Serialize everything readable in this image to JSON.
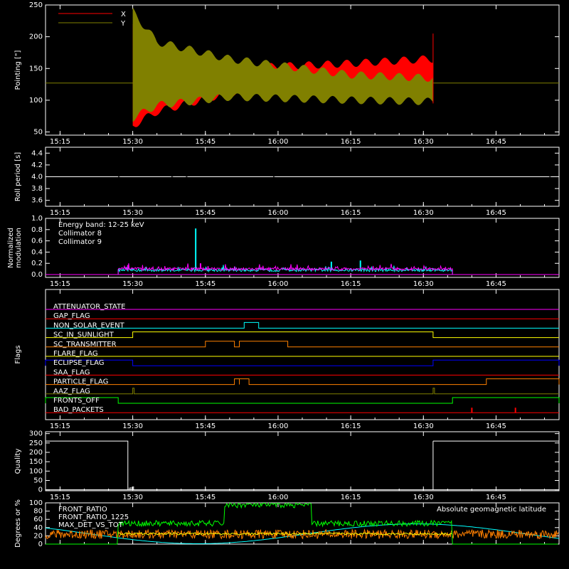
{
  "time_axis": {
    "ticks": [
      "15:15",
      "15:30",
      "15:45",
      "16:00",
      "16:15",
      "16:30",
      "16:45"
    ],
    "range": [
      "15:12",
      "16:58"
    ]
  },
  "chart_data": [
    {
      "id": "pointing",
      "type": "area",
      "ylabel": "Pointing [\"]",
      "ylim": [
        45,
        250
      ],
      "yticks": [
        "50",
        "100",
        "150",
        "200",
        "250"
      ],
      "legend_position": "top-left",
      "series": [
        {
          "name": "X",
          "color": "#ff0000",
          "baseline": 127,
          "t_start": "15:30",
          "t_end": "16:32",
          "envelope_upper": [
            [
              0,
              220
            ],
            [
              5,
              175
            ],
            [
              20,
              150
            ],
            [
              45,
              158
            ],
            [
              61,
              165
            ]
          ],
          "envelope_lower": [
            [
              0,
              60
            ],
            [
              5,
              82
            ],
            [
              20,
              112
            ],
            [
              45,
              125
            ],
            [
              61,
              120
            ]
          ]
        },
        {
          "name": "Y",
          "color": "#808000",
          "baseline": 127,
          "t_start": "15:30",
          "t_end": "16:32",
          "envelope_upper": [
            [
              0,
              240
            ],
            [
              5,
              192
            ],
            [
              20,
              165
            ],
            [
              45,
              140
            ],
            [
              61,
              135
            ]
          ],
          "envelope_lower": [
            [
              0,
              72
            ],
            [
              5,
              92
            ],
            [
              20,
              105
            ],
            [
              45,
              100
            ],
            [
              61,
              98
            ]
          ]
        }
      ]
    },
    {
      "id": "roll",
      "type": "line",
      "ylabel": "Roll period [s]",
      "ylim": [
        3.5,
        4.5
      ],
      "yticks": [
        "3.6",
        "3.8",
        "4.0",
        "4.2",
        "4.4"
      ],
      "value": 4.0,
      "color": "#ffffff"
    },
    {
      "id": "modulation",
      "type": "line",
      "ylabel": [
        "Normalized",
        "modulation"
      ],
      "ylim": [
        -0.05,
        1.0
      ],
      "yticks": [
        "0.0",
        "0.2",
        "0.4",
        "0.6",
        "0.8",
        "1.0"
      ],
      "annotation": "Energy band: 12-25 keV",
      "t_start": "15:27",
      "t_end": "16:36",
      "series": [
        {
          "name": "Collimator 8",
          "color": "#00ffff",
          "level": 0.08,
          "spikes": [
            [
              "15:43",
              0.82
            ],
            [
              "16:11",
              0.23
            ],
            [
              "16:17",
              0.25
            ]
          ]
        },
        {
          "name": "Collimator 9",
          "color": "#ff00ff",
          "level": 0.1,
          "spikes": [
            [
              "15:29",
              0.17
            ],
            [
              "15:44",
              0.2
            ]
          ]
        }
      ]
    },
    {
      "id": "flags",
      "type": "line",
      "ylabel": "Flags",
      "rows": [
        {
          "name": "ATTENUATOR_STATE",
          "color": "#ff00ff",
          "steps": []
        },
        {
          "name": "GAP_FLAG",
          "color": "#ff0000",
          "steps": []
        },
        {
          "name": "NON_SOLAR_EVENT",
          "color": "#00ffff",
          "steps": [
            [
              "15:53",
              "15:56"
            ]
          ]
        },
        {
          "name": "SC_IN_SUNLIGHT",
          "color": "#ffff00",
          "steps": [
            [
              "15:30",
              "16:32"
            ]
          ]
        },
        {
          "name": "SC_TRANSMITTER",
          "color": "#ff8000",
          "steps": [
            [
              "15:45",
              "15:51"
            ],
            [
              "15:52",
              "16:02"
            ]
          ]
        },
        {
          "name": "FLARE_FLAG",
          "color": "#ffff00",
          "steps": []
        },
        {
          "name": "ECLIPSE_FLAG",
          "color": "#0000ff",
          "steps": [
            [
              "15:12",
              "15:30"
            ],
            [
              "16:32",
              "16:58"
            ]
          ]
        },
        {
          "name": "SAA_FLAG",
          "color": "#ff0000",
          "steps": []
        },
        {
          "name": "PARTICLE_FLAG",
          "color": "#ff8000",
          "steps": [
            [
              "15:51",
              "15:52"
            ],
            [
              "15:52",
              "15:54"
            ],
            [
              "16:43",
              "16:58"
            ]
          ]
        },
        {
          "name": "AAZ_FLAG",
          "color": "#808000",
          "steps": [
            [
              "15:30",
              "15:30"
            ],
            [
              "16:32",
              "16:32"
            ]
          ]
        },
        {
          "name": "FRONTS_OFF",
          "color": "#00ff00",
          "steps": [
            [
              "15:12",
              "15:27"
            ],
            [
              "16:36",
              "16:58"
            ]
          ]
        },
        {
          "name": "BAD_PACKETS",
          "color": "#ff0000",
          "steps": [],
          "ticks": [
            "16:40",
            "16:49"
          ]
        }
      ]
    },
    {
      "id": "quality",
      "type": "line",
      "ylabel": "Quality",
      "ylim": [
        -5,
        310
      ],
      "yticks": [
        "0",
        "50",
        "100",
        "150",
        "200",
        "250",
        "300"
      ],
      "color": "#ffffff",
      "high": 260,
      "segments": [
        [
          "15:12",
          "15:29"
        ],
        [
          "16:32",
          "16:58"
        ]
      ]
    },
    {
      "id": "ratios",
      "type": "line",
      "ylabel": "Degrees or %",
      "ylim": [
        0,
        100
      ],
      "yticks": [
        "0",
        "20",
        "40",
        "60",
        "80",
        "100"
      ],
      "legend_position": "top-left",
      "series": [
        {
          "name": "FRONT_RATIO",
          "color": "#ffff00"
        },
        {
          "name": "FRONT_RATIO_1225",
          "color": "#00ff00"
        },
        {
          "name": "MAX_DET_VS_TOT",
          "color": "#ff8000"
        }
      ],
      "latitude_label": "Absolute geomagnetic latitude",
      "latitude_color": "#00ffff",
      "green_levels": [
        [
          "15:12",
          "15:27",
          0
        ],
        [
          "15:27",
          "15:49",
          50
        ],
        [
          "15:49",
          "16:07",
          95
        ],
        [
          "16:07",
          "16:36",
          50
        ],
        [
          "16:36",
          "16:58",
          0
        ]
      ]
    }
  ]
}
